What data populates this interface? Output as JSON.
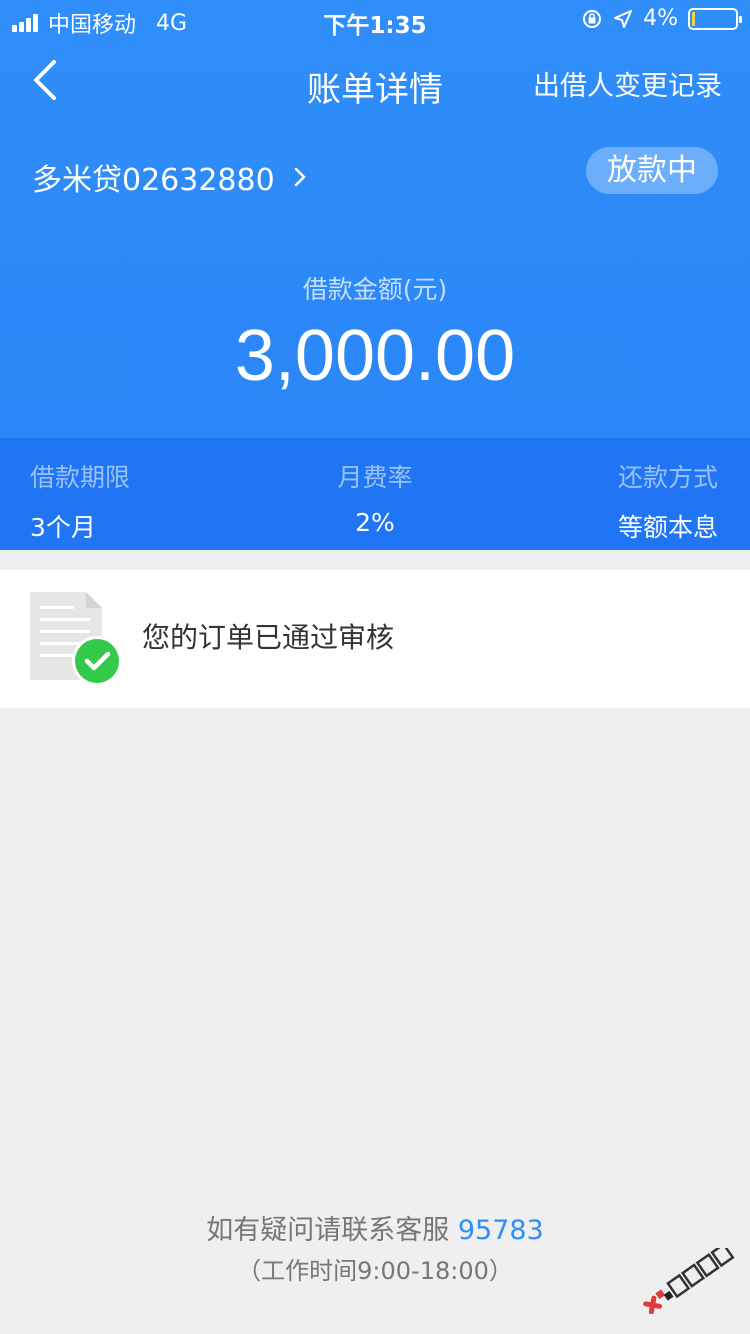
{
  "status_bar": {
    "carrier": "中国移动",
    "network": "4G",
    "time": "下午1:35",
    "battery": "4%"
  },
  "nav": {
    "title": "账单详情",
    "action": "出借人变更记录"
  },
  "loan": {
    "id": "多米贷02632880",
    "status": "放款中",
    "amount_label": "借款金额(元)",
    "amount": "3,000.00"
  },
  "terms": [
    {
      "label": "借款期限",
      "value": "3个月"
    },
    {
      "label": "月费率",
      "value": "2%"
    },
    {
      "label": "还款方式",
      "value": "等额本息"
    }
  ],
  "review": {
    "text": "您的订单已通过审核"
  },
  "footer": {
    "contact_text": "如有疑问请联系客服",
    "phone": "95783",
    "hours": "（工作时间9:00-18:00）"
  },
  "watermark": {
    "text": "卡农社区"
  },
  "colors": {
    "primary": "#2f8ef9",
    "terms_bg": "#1f75f3",
    "success": "#35c94a",
    "background": "#efeff0"
  }
}
